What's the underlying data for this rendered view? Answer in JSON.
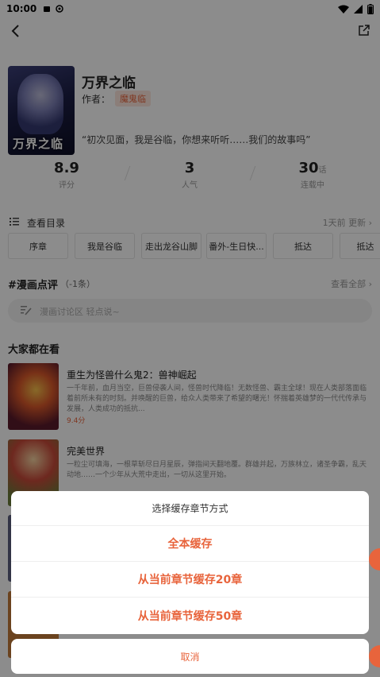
{
  "status_bar": {
    "time": "10:00"
  },
  "comic": {
    "cover_text": "万界之临",
    "title": "万界之临",
    "author_label": "作者：",
    "author": "魔鬼临",
    "quote": "“初次见面，我是谷临，你想来听听……我们的故事吗”"
  },
  "stats": [
    {
      "value": "8.9",
      "unit": "",
      "label": "评分"
    },
    {
      "value": "3",
      "unit": "",
      "label": "人气"
    },
    {
      "value": "30",
      "unit": "话",
      "label": "连载中"
    }
  ],
  "toc": {
    "label": "查看目录",
    "update": "1天前 更新 ›"
  },
  "chapters": [
    "序章",
    "我是谷临",
    "走出龙谷山脚",
    "番外-生日快...",
    "抵达",
    "抵达（"
  ],
  "comments": {
    "heading": "#漫画点评",
    "count": "（-1条）",
    "more": "查看全部 ›",
    "placeholder": "漫画讨论区 轻点说~"
  },
  "recommend": {
    "heading": "大家都在看",
    "items": [
      {
        "name": "重生为怪兽什么鬼2：兽神崛起",
        "desc": "一千年前，血月当空，巨兽侵袭人间，怪兽时代降临！无数怪兽、霸主全球！现在人类部落面临着前所未有的时刻。并唤醒的巨兽，给众人类带来了希望的曙光！怀揣着英雄梦的一代代传承与发展，人类成功的抵抗...",
        "score": "9.4分"
      },
      {
        "name": "完美世界",
        "desc": "一粒尘可填海，一根草斩尽日月星辰，弹指间天翻地覆。群雄并起，万族林立，诸圣争霸，乱天动地……一个少年从大荒中走出，一切从这里开始。",
        "score": ""
      }
    ]
  },
  "sheet": {
    "title": "选择缓存章节方式",
    "options": [
      "全本缓存",
      "从当前章节缓存20章",
      "从当前章节缓存50章"
    ],
    "cancel": "取消"
  }
}
